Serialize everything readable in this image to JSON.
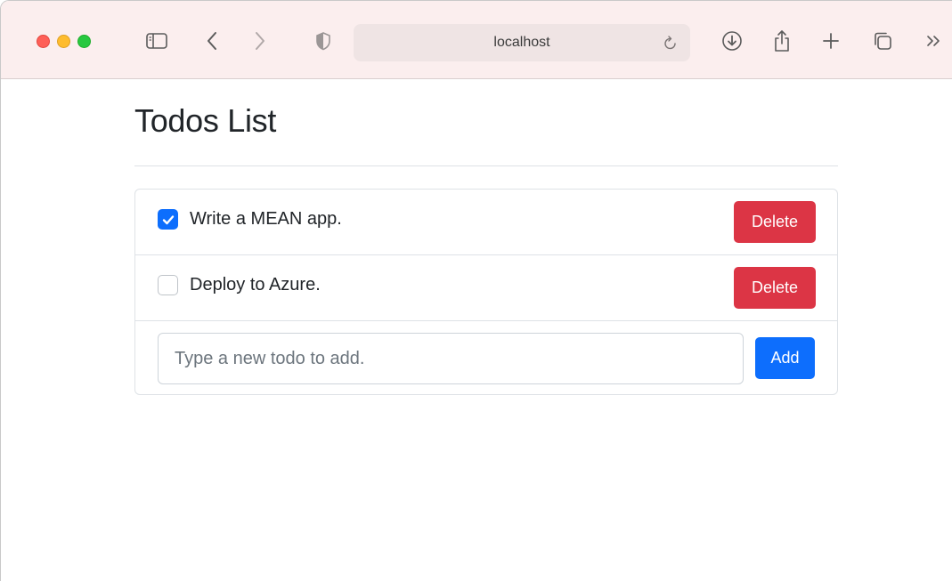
{
  "browser": {
    "url": "localhost",
    "icons": [
      "sidebar-icon",
      "back-icon",
      "forward-icon",
      "shield-icon",
      "reload-icon",
      "download-icon",
      "share-icon",
      "plus-icon",
      "tabs-icon",
      "more-icon"
    ]
  },
  "page": {
    "title": "Todos List"
  },
  "todos": [
    {
      "text": "Write a MEAN app.",
      "done": true,
      "delete_label": "Delete"
    },
    {
      "text": "Deploy to Azure.",
      "done": false,
      "delete_label": "Delete"
    }
  ],
  "new_todo": {
    "placeholder": "Type a new todo to add.",
    "value": "",
    "add_label": "Add"
  },
  "colors": {
    "primary": "#0d6efd",
    "danger": "#dc3545",
    "toolbar_bg": "#fbeeee"
  }
}
